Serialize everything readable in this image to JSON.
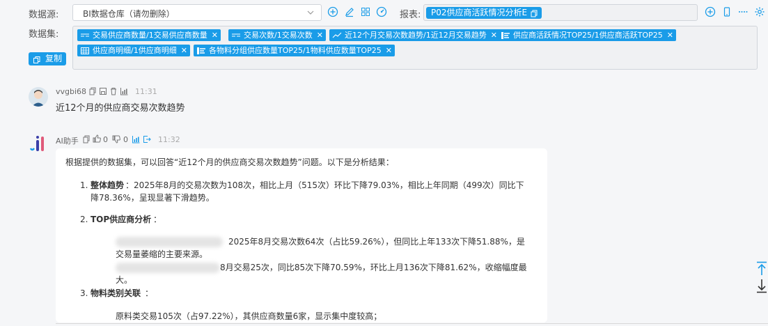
{
  "header": {
    "datasource_label": "数据源:",
    "datasource_value": "BI数据仓库（请勿删除）",
    "report_label": "报表:",
    "report_tag": "P02供应商活跃情况分析E",
    "dataset_label": "数据集:",
    "copy_label": "复制"
  },
  "datasets": [
    "交易供应商数量/1交易供应商数量",
    "交易次数/1交易次数",
    "近12个月交易次数趋势/1近12月交易趋势",
    "供应商活跃情况TOP25/1供应商活跃TOP25",
    "供应商明细/1供应商明细",
    "各物料分组供应数量TOP25/1物料供应数量TOP25"
  ],
  "user_message": {
    "username": "vvgbi68",
    "time": "11:31",
    "text": "近12个月的供应商交易次数趋势"
  },
  "ai_message": {
    "username": "AI助手",
    "likes": "0",
    "dislikes": "0",
    "time": "11:32",
    "intro": "根据提供的数据集，可以回答“近12个月的供应商交易次数趋势”问题。以下是分析结果：",
    "item1_num": "1.",
    "item1_title": "整体趋势",
    "item1_line1": "：2025年8月的交易次数为108次，相比上月（515次）环比下降79.03%，相比上年同期（499次）同比下",
    "item1_line2": "降78.36%，呈现显著下滑趋势。",
    "item2_num": "2.",
    "item2_title": "TOP供应商分析",
    "item2_colon": "：",
    "item2_sub1_line1": "2025年8月交易次数64次（占比59.26%），但同比上年133次下降51.88%，是",
    "item2_sub1_line2": "交易量萎缩的主要来源。",
    "item2_sub2_line1": "8月交易25次，同比85次下降70.59%，环比上月136次下降81.62%，收缩幅度最",
    "item2_sub2_line2": "大。",
    "item3_num": "3.",
    "item3_title": "物料类别关联",
    "item3_colon": "：",
    "item3_sub1": "原料类交易105次（占97.22%），其供应商数量6家，显示集中度较高；"
  },
  "colors": {
    "accent": "#1a9ce8"
  }
}
